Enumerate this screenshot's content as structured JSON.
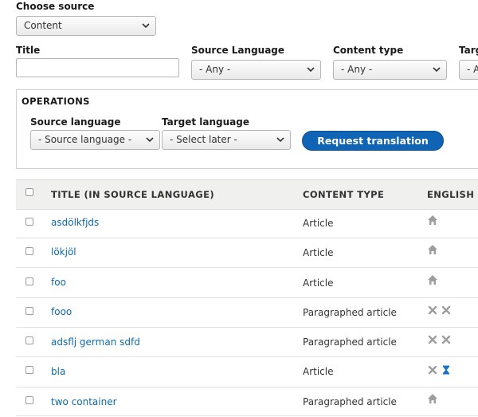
{
  "filters": {
    "choose_source_label": "Choose source",
    "choose_source_value": "Content",
    "title_label": "Title",
    "title_value": "",
    "source_language_label": "Source Language",
    "source_language_value": "- Any -",
    "content_type_label": "Content type",
    "content_type_value": "- Any -",
    "target_label": "Targ",
    "target_value": "- A"
  },
  "operations": {
    "heading": "OPERATIONS",
    "source_language_label": "Source language",
    "source_language_value": "- Source language -",
    "target_language_label": "Target language",
    "target_language_value": "- Select later -",
    "request_button": "Request translation"
  },
  "table": {
    "headers": {
      "title": "TITLE (IN SOURCE LANGUAGE)",
      "content_type": "CONTENT TYPE",
      "english": "ENGLISH"
    },
    "rows": [
      {
        "title": "asdölkfjds",
        "type": "Article",
        "status": [
          "home-icon"
        ]
      },
      {
        "title": "lökjöl",
        "type": "Article",
        "status": [
          "home-icon"
        ]
      },
      {
        "title": "foo",
        "type": "Article",
        "status": [
          "home-icon"
        ]
      },
      {
        "title": "fooo",
        "type": "Paragraphed article",
        "status": [
          "x-icon",
          "x-icon"
        ]
      },
      {
        "title": "adsflj german sdfd",
        "type": "Paragraphed article",
        "status": [
          "x-icon",
          "x-icon"
        ]
      },
      {
        "title": "bla",
        "type": "Article",
        "status": [
          "x-icon",
          "hourglass-icon"
        ]
      },
      {
        "title": "two container",
        "type": "Paragraphed article",
        "status": [
          "home-icon"
        ]
      }
    ]
  },
  "colors": {
    "link": "#0d6aa8",
    "primary_button": "#1064b5",
    "status_icon_gray": "#9e9e9e",
    "pending_icon_blue": "#1a73c9"
  }
}
